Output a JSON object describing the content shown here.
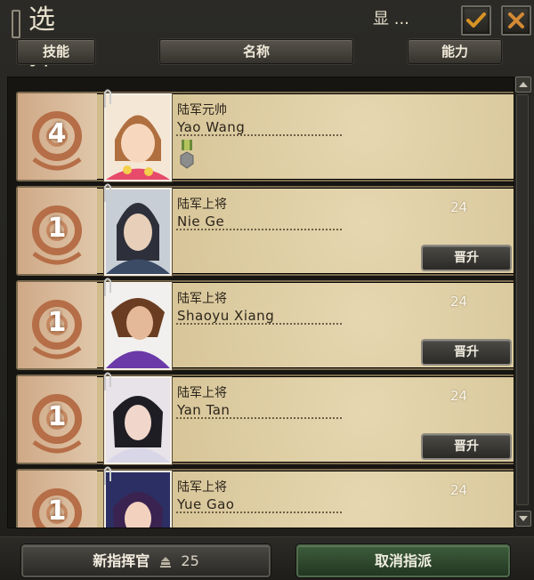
{
  "window": {
    "title": "选择一名指挥官",
    "show_label": "显 ..."
  },
  "header": {
    "skill": "技能",
    "name": "名称",
    "ability": "能力"
  },
  "commanders": [
    {
      "level": "4",
      "rank": "陆军元帅",
      "name": "Yao Wang",
      "power": "",
      "has_medal": true,
      "promote": ""
    },
    {
      "level": "1",
      "rank": "陆军上将",
      "name": "Nie Ge",
      "power": "24",
      "has_medal": false,
      "promote": "晋升"
    },
    {
      "level": "1",
      "rank": "陆军上将",
      "name": "Shaoyu Xiang",
      "power": "24",
      "has_medal": false,
      "promote": "晋升"
    },
    {
      "level": "1",
      "rank": "陆军上将",
      "name": "Yan Tan",
      "power": "24",
      "has_medal": false,
      "promote": "晋升"
    },
    {
      "level": "1",
      "rank": "陆军上将",
      "name": "Yue Gao",
      "power": "24",
      "has_medal": false,
      "promote": ""
    }
  ],
  "footer": {
    "new_commander": "新指挥官",
    "cost": "25",
    "cancel": "取消指派"
  },
  "colors": {
    "parchment": "#dcc9a0",
    "emblem": "#d2ad8a",
    "confirm_check": "#d89424",
    "close_x": "#d48a34",
    "cancel_green": "#355233"
  },
  "icons": [
    "confirm-check-icon",
    "close-x-icon",
    "emblem-icon",
    "medal-icon",
    "coin-icon",
    "scroll-up-icon",
    "scroll-down-icon"
  ]
}
